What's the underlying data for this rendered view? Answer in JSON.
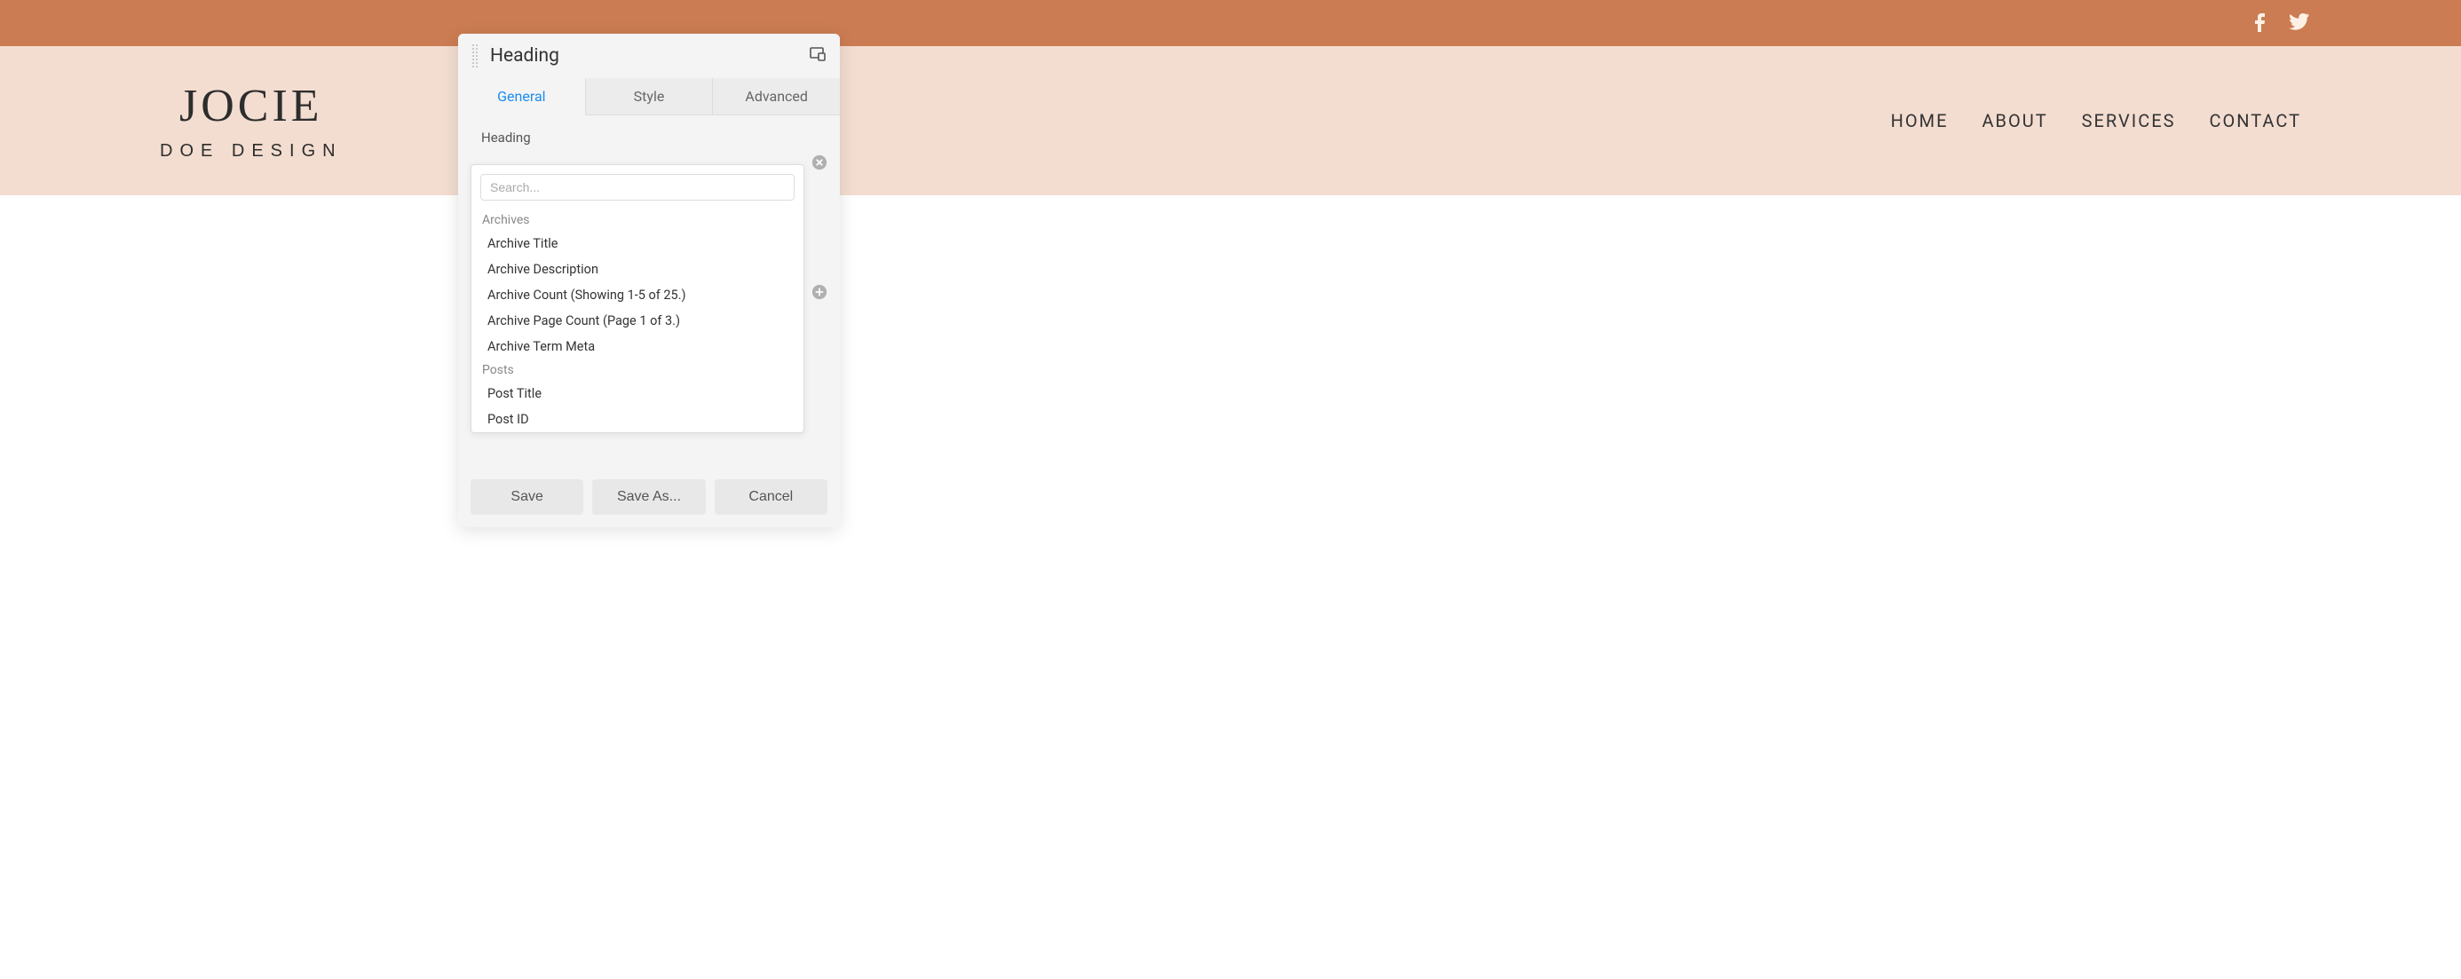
{
  "topbar": {
    "social": [
      "facebook",
      "twitter"
    ]
  },
  "header": {
    "logo_title": "JOCIE",
    "logo_subtitle": "DOE DESIGN",
    "nav": [
      "HOME",
      "ABOUT",
      "SERVICES",
      "CONTACT"
    ]
  },
  "modal": {
    "title": "Heading",
    "tabs": {
      "general": "General",
      "style": "Style",
      "advanced": "Advanced"
    },
    "field_label": "Heading",
    "search_placeholder": "Search...",
    "groups": [
      {
        "label": "Archives",
        "items": [
          "Archive Title",
          "Archive Description",
          "Archive Count (Showing 1-5 of 25.)",
          "Archive Page Count (Page 1 of 3.)",
          "Archive Term Meta"
        ]
      },
      {
        "label": "Posts",
        "items": [
          "Post Title",
          "Post ID"
        ]
      }
    ],
    "buttons": {
      "save": "Save",
      "save_as": "Save As...",
      "cancel": "Cancel"
    }
  }
}
